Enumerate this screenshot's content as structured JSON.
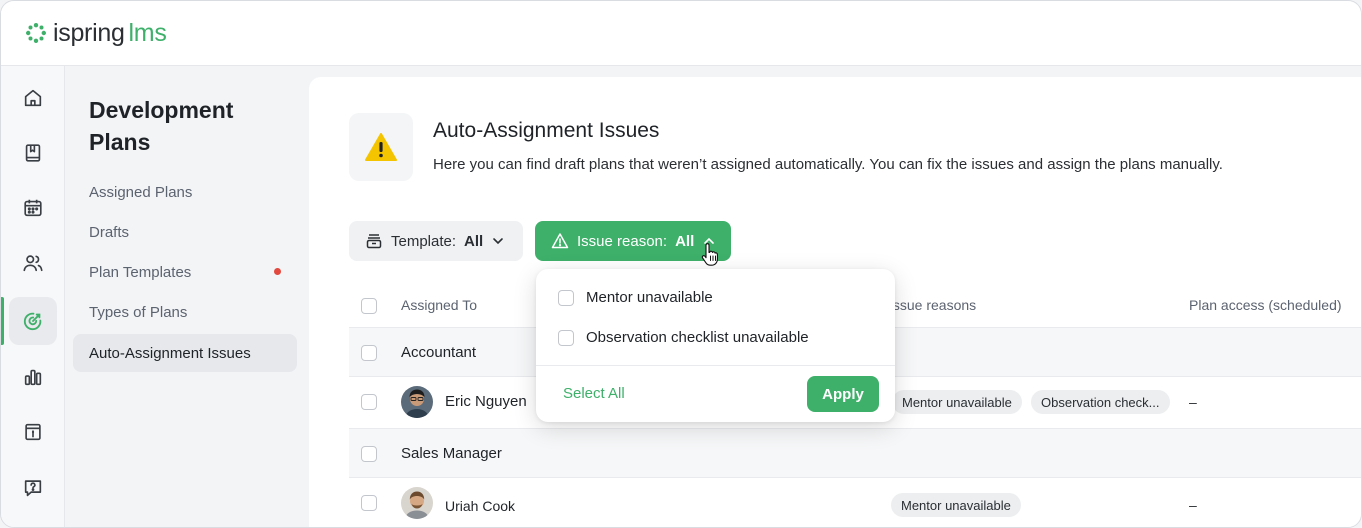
{
  "app": {
    "logo_main": "ispring",
    "logo_accent": "lms",
    "accent_color": "#3eb06a"
  },
  "rail": {
    "items": [
      {
        "icon": "home-icon"
      },
      {
        "icon": "book-icon"
      },
      {
        "icon": "calendar-icon"
      },
      {
        "icon": "users-icon"
      },
      {
        "icon": "target-icon",
        "active": true
      },
      {
        "icon": "bar-chart-icon"
      },
      {
        "icon": "info-box-icon"
      },
      {
        "icon": "help-chat-icon"
      }
    ]
  },
  "subnav": {
    "title": "Development Plans",
    "items": [
      {
        "label": "Assigned Plans"
      },
      {
        "label": "Drafts"
      },
      {
        "label": "Plan Templates",
        "dot": true
      },
      {
        "label": "Types of Plans"
      },
      {
        "label": "Auto-Assignment Issues",
        "active": true
      }
    ]
  },
  "header": {
    "title": "Auto-Assignment Issues",
    "subtitle": "Here you can find draft plans that weren’t assigned automatically. You can fix the issues and assign the plans manually."
  },
  "filters": {
    "template_label": "Template:",
    "template_value": "All",
    "issue_label": "Issue reason:",
    "issue_value": "All"
  },
  "table": {
    "col_assigned_to": "Assigned To",
    "col_issue_reasons": "Issue reasons",
    "col_plan_access": "Plan access (scheduled)",
    "group_1": "Accountant",
    "group_2": "Sales Manager",
    "person_1": {
      "name": "Eric Nguyen",
      "tag_1": "Mentor unavailable",
      "tag_2": "Observation check...",
      "access": "–"
    },
    "person_2": {
      "name": "Uriah Cook",
      "tag_1": "Mentor unavailable",
      "access": "–"
    }
  },
  "dropdown": {
    "option_1": "Mentor unavailable",
    "option_2": "Observation checklist unavailable",
    "select_all": "Select All",
    "apply": "Apply"
  }
}
